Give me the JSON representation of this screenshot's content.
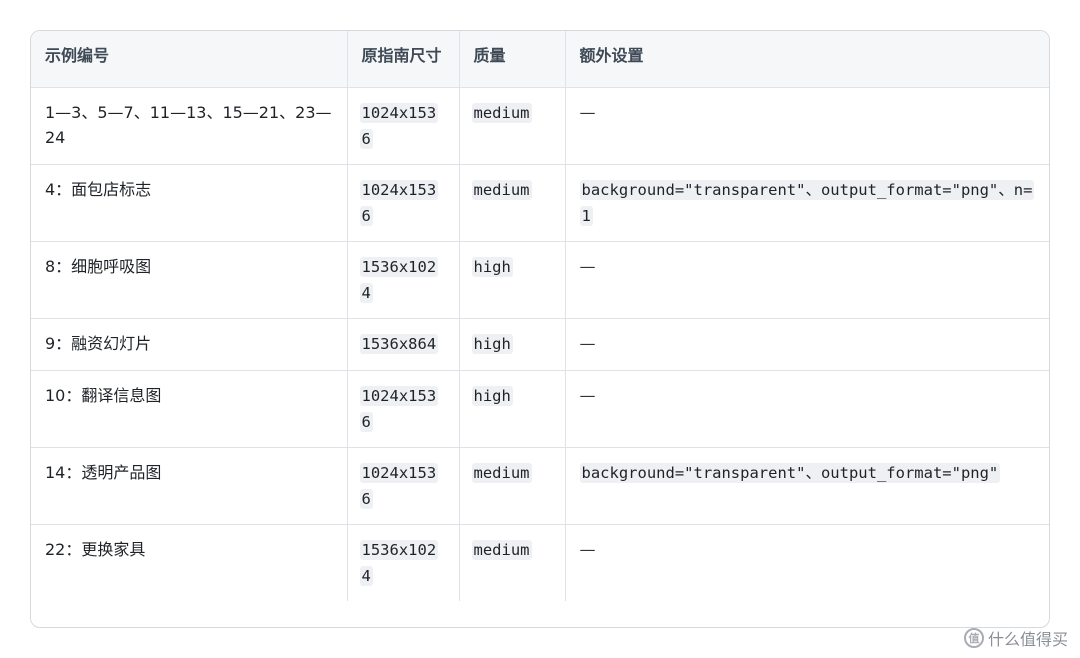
{
  "table": {
    "headers": [
      "示例编号",
      "原指南尺寸",
      "质量",
      "额外设置"
    ],
    "rows": [
      {
        "example": "1—3、5—7、11—13、15—21、23—24",
        "size": "1024x1536",
        "quality": "medium",
        "extra": "—",
        "extra_is_code": false
      },
      {
        "example": "4：面包店标志",
        "size": "1024x1536",
        "quality": "medium",
        "extra": "background=\"transparent\"、output_format=\"png\"、n=1",
        "extra_is_code": true
      },
      {
        "example": "8：细胞呼吸图",
        "size": "1536x1024",
        "quality": "high",
        "extra": "—",
        "extra_is_code": false
      },
      {
        "example": "9：融资幻灯片",
        "size": "1536x864",
        "quality": "high",
        "extra": "—",
        "extra_is_code": false
      },
      {
        "example": "10：翻译信息图",
        "size": "1024x1536",
        "quality": "high",
        "extra": "—",
        "extra_is_code": false
      },
      {
        "example": "14：透明产品图",
        "size": "1024x1536",
        "quality": "medium",
        "extra": "background=\"transparent\"、output_format=\"png\"",
        "extra_is_code": true
      },
      {
        "example": "22：更换家具",
        "size": "1536x1024",
        "quality": "medium",
        "extra": "—",
        "extra_is_code": false
      }
    ]
  },
  "watermark": {
    "icon": "zhi-icon",
    "icon_glyph": "值",
    "text": "什么值得买"
  }
}
